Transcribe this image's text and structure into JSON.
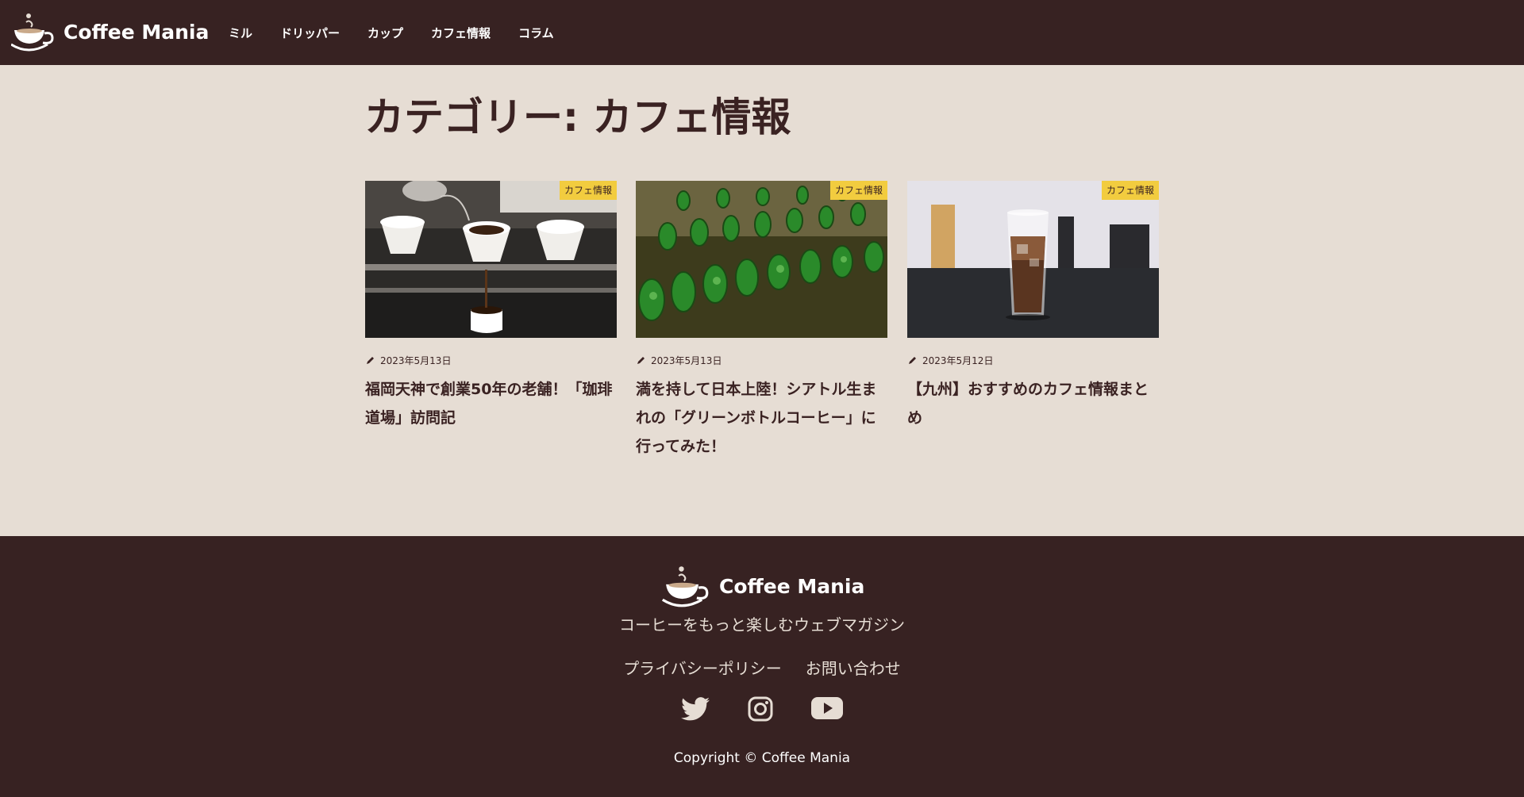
{
  "site": {
    "name": "Coffee Mania"
  },
  "nav": {
    "items": [
      "ミル",
      "ドリッパー",
      "カップ",
      "カフェ情報",
      "コラム"
    ]
  },
  "page": {
    "title": "カテゴリー: カフェ情報"
  },
  "posts": [
    {
      "category": "カフェ情報",
      "date": "2023年5月13日",
      "title": "福岡天神で創業50年の老舗！「珈琲道場」訪問記",
      "image": "pour-over-coffee-photo"
    },
    {
      "category": "カフェ情報",
      "date": "2023年5月13日",
      "title": "満を持して日本上陸！シアトル生まれの「グリーンボトルコーヒー」に行ってみた！",
      "image": "green-bottles-photo"
    },
    {
      "category": "カフェ情報",
      "date": "2023年5月12日",
      "title": "【九州】おすすめのカフェ情報まとめ",
      "image": "iced-coffee-photo"
    }
  ],
  "footer": {
    "tagline": "コーヒーをもっと楽しむウェブマガジン",
    "links": [
      "プライバシーポリシー",
      "お問い合わせ"
    ],
    "social": [
      "twitter-icon",
      "instagram-icon",
      "youtube-icon"
    ],
    "copyright": "Copyright © Coffee Mania"
  },
  "colors": {
    "dark": "#372222",
    "bg": "#e6ddd4",
    "badge": "#f2cc3f"
  }
}
